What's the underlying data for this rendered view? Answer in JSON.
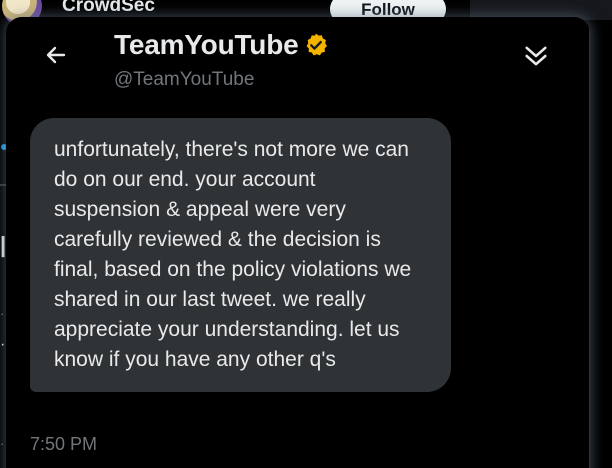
{
  "background": {
    "account_name": "CrowdSec",
    "follow_label": "Follow"
  },
  "conversation": {
    "title": "TeamYouTube",
    "handle": "@TeamYouTube",
    "verified": true,
    "verified_color": "#f4b400"
  },
  "messages": [
    {
      "text": "unfortunately, there's not more we can do on our end. your account suspension & appeal were very carefully reviewed & the decision is final, based on the policy violations we shared in our last tweet. we really appreciate your understanding. let us know if you have any other q's",
      "time": "7:50 PM"
    }
  ],
  "icons": {
    "back": "arrow-left-icon",
    "collapse": "double-chevron-down-icon",
    "verified": "verified-badge-icon"
  },
  "colors": {
    "background": "#000000",
    "bubble": "#2f3336",
    "text_primary": "#e7e9ea",
    "text_secondary": "#71767b",
    "accent": "#1d9bf0"
  }
}
